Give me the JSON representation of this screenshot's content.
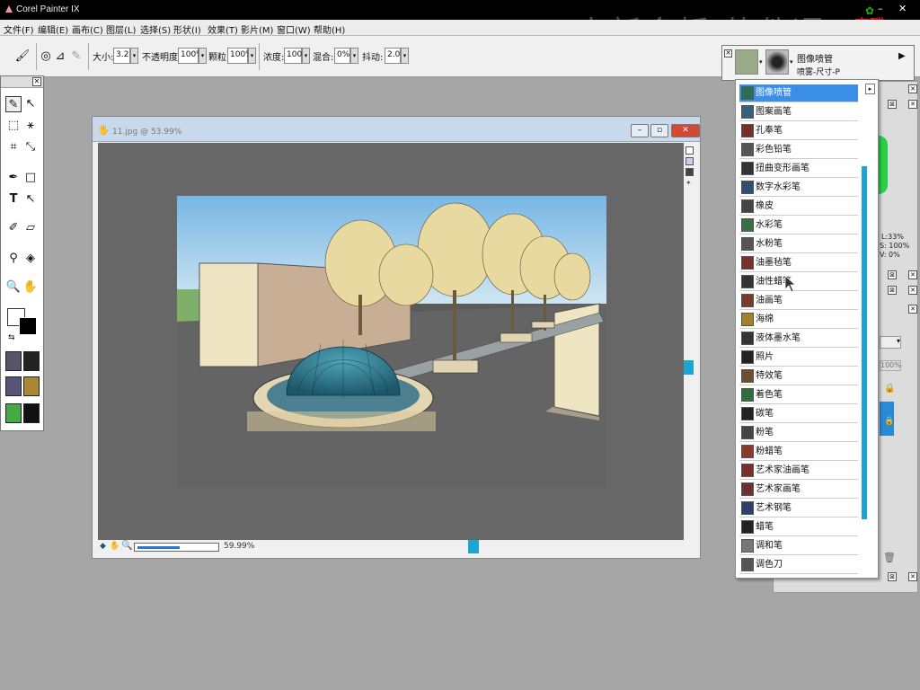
{
  "app": {
    "title": "Corel Painter IX"
  },
  "watermark": {
    "text": "中新金桥 软件通",
    "badge_line1": "育碟",
    "badge_line2": "软件"
  },
  "menu": [
    "文件(F)",
    "编辑(E)",
    "画布(C)",
    "图层(L)",
    "选择(S)",
    "形状(I)",
    "效果(T)",
    "影片(M)",
    "窗口(W)",
    "帮助(H)"
  ],
  "toolbar": {
    "size_label": "大小:",
    "size_value": "3.2",
    "opacity_label": "不透明度:",
    "opacity_value": "100%",
    "grain_label": "颗粒:",
    "grain_value": "100%",
    "resat_label": "浓度:",
    "resat_value": "100%",
    "bleed_label": "混合:",
    "bleed_value": "0%",
    "jitter_label": "抖动:",
    "jitter_value": "2.00"
  },
  "document": {
    "title": "11.jpg @ 53.99%",
    "zoom": "59.99%",
    "zoom_fraction": 0.53
  },
  "brush_selector": {
    "category": "图像喷管",
    "variant": "喷雾-尺寸-P"
  },
  "brush_categories": [
    "图像喷管",
    "图案画笔",
    "孔奉笔",
    "彩色铅笔",
    "扭曲变形画笔",
    "数字水彩笔",
    "橡皮",
    "水彩笔",
    "水粉笔",
    "油墨毡笔",
    "油性蜡笔",
    "油画笔",
    "海绵",
    "液体墨水笔",
    "照片",
    "特效笔",
    "着色笔",
    "碳笔",
    "粉笔",
    "粉蜡笔",
    "艺术家油画笔",
    "艺术家画笔",
    "艺术钢笔",
    "蜡笔",
    "调和笔",
    "调色刀"
  ],
  "side_panel": {
    "v1": "L:33%",
    "v2": "S: 100%",
    "v3": "V: 0%",
    "pct": "100%"
  }
}
